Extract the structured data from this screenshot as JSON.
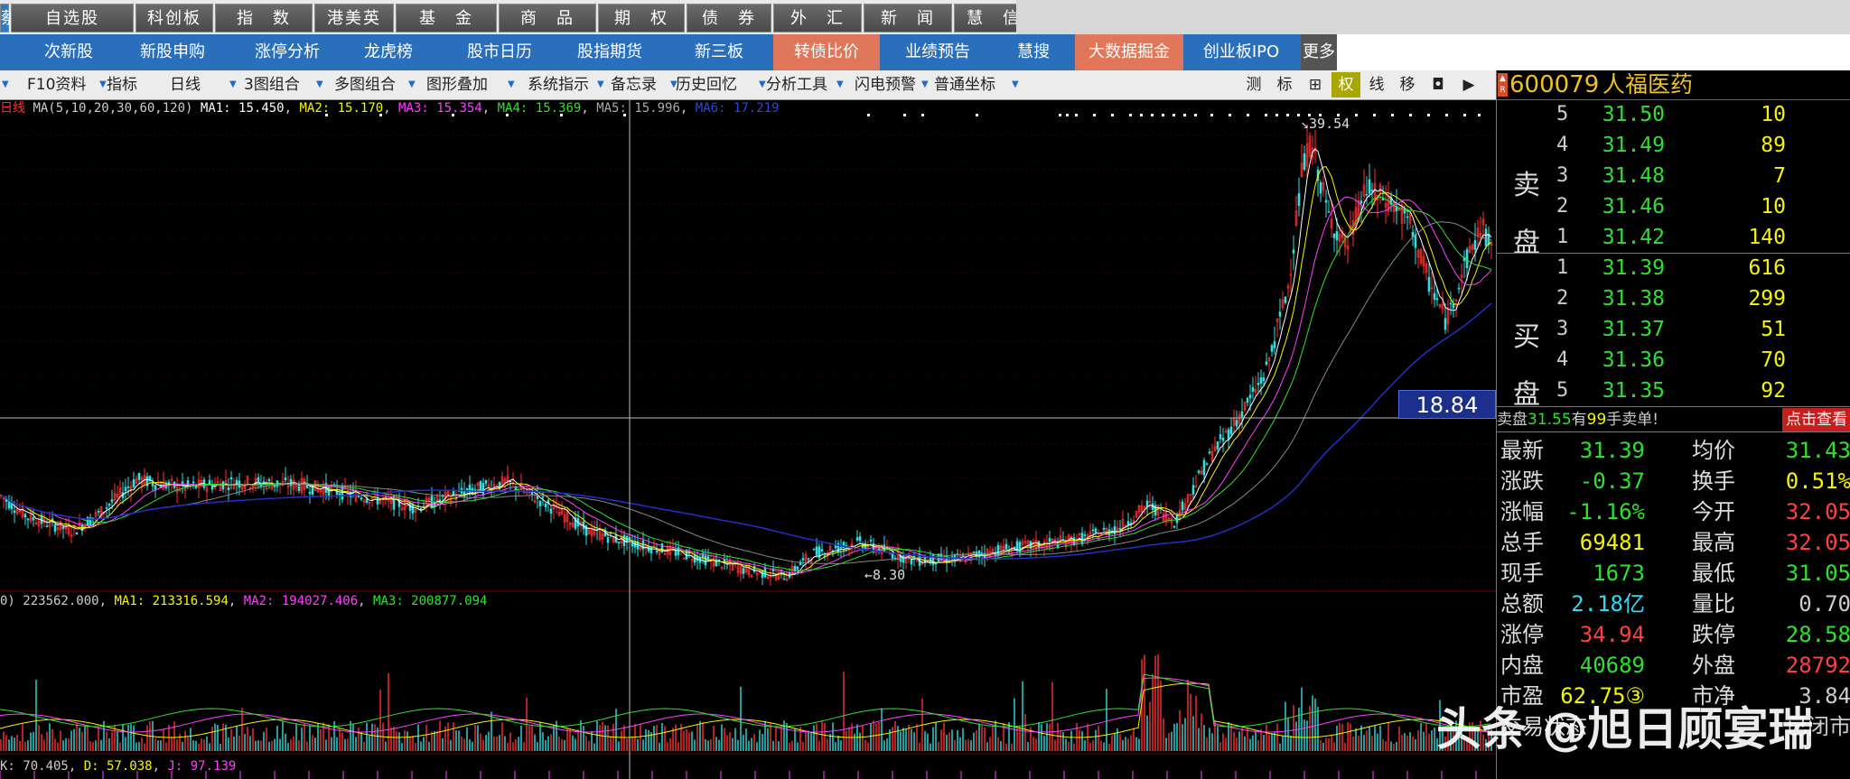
{
  "top_tabs": [
    "蔡",
    "自选股",
    "科创板",
    "指　数",
    "港美英",
    "基　金",
    "商　品",
    "期　权",
    "债　券",
    "外　汇",
    "新　闻",
    "慧　信"
  ],
  "nav_items": [
    "次新股",
    "新股申购",
    "涨停分析",
    "龙虎榜",
    "股市日历",
    "股指期货",
    "新三板",
    "转债比价",
    "业绩预告",
    "慧搜",
    "大数据掘金",
    "创业板IPO",
    "更多"
  ],
  "toolbar": [
    "F10资料",
    "指标",
    "日线",
    "3图组合",
    "多图组合",
    "图形叠加",
    "系统指示",
    "备忘录",
    "历史回忆",
    "分析工具",
    "闪电预警",
    "普通坐标"
  ],
  "right_tools": [
    "测",
    "标",
    "⊞",
    "权",
    "线",
    "移",
    "◘",
    "▶"
  ],
  "chart_info": {
    "label": "日线",
    "ma": "MA(5,10,20,30,60,120)",
    "ma1": "MA1: 15.450",
    "ma2": "MA2: 15.170",
    "ma3": "MA3: 15.354",
    "ma4": "MA4: 15.369",
    "ma5": "MA5: 15.996",
    "ma6": "MA6: 17.219",
    "high_label": "39.54",
    "low_label": "8.30",
    "cursor_price": "18.84"
  },
  "volume_info": {
    "v": "0) 223562.000",
    "ma1": "MA1: 213316.594",
    "ma2": "MA2: 194027.406",
    "ma3": "MA3: 200877.094"
  },
  "kdj_info": {
    "k": "K: 70.405",
    "d": "D: 57.038",
    "j": "J: 97.139"
  },
  "quote": {
    "code": "600079",
    "name": "人福医药",
    "sell_label": "卖\n盘",
    "buy_label": "买\n盘",
    "sell": [
      {
        "level": "5",
        "price": "31.50",
        "vol": "10"
      },
      {
        "level": "4",
        "price": "31.49",
        "vol": "89"
      },
      {
        "level": "3",
        "price": "31.48",
        "vol": "7"
      },
      {
        "level": "2",
        "price": "31.46",
        "vol": "10"
      },
      {
        "level": "1",
        "price": "31.42",
        "vol": "140"
      }
    ],
    "buy": [
      {
        "level": "1",
        "price": "31.39",
        "vol": "616"
      },
      {
        "level": "2",
        "price": "31.38",
        "vol": "299"
      },
      {
        "level": "3",
        "price": "31.37",
        "vol": "51"
      },
      {
        "level": "4",
        "price": "31.36",
        "vol": "70"
      },
      {
        "level": "5",
        "price": "31.35",
        "vol": "92"
      }
    ],
    "sell_notice_pre": "卖盘",
    "sell_notice_price": "31.55",
    "sell_notice_mid": "有",
    "sell_notice_qty": "99",
    "sell_notice_post": "手卖单!",
    "click_view": "点击查看",
    "stats": [
      {
        "l": "最新",
        "lv": "31.39",
        "r": "均价",
        "rv": "31.43"
      },
      {
        "l": "涨跌",
        "lv": "-0.37",
        "r": "换手",
        "rv": "0.51%"
      },
      {
        "l": "涨幅",
        "lv": "-1.16%",
        "r": "今开",
        "rv": "32.05"
      },
      {
        "l": "总手",
        "lv": "69481",
        "r": "最高",
        "rv": "32.05"
      },
      {
        "l": "现手",
        "lv": "1673",
        "r": "最低",
        "rv": "31.05"
      },
      {
        "l": "总额",
        "lv": "2.18亿",
        "r": "量比",
        "rv": "0.70"
      },
      {
        "l": "涨停",
        "lv": "34.94",
        "r": "跌停",
        "rv": "28.58"
      },
      {
        "l": "内盘",
        "lv": "40689",
        "r": "外盘",
        "rv": "28792"
      },
      {
        "l": "市盈",
        "lv": "62.75③",
        "r": "市净",
        "rv": "3.84"
      },
      {
        "l": "交易状态",
        "lv": "",
        "r": "",
        "rv": "已闭市"
      }
    ]
  },
  "watermark": "头条 @旭日顾宴瑞",
  "colors": {
    "up": "#ff4040",
    "down": "#30e030",
    "flat": "#ccc",
    "yellow": "#f5f500",
    "cyan": "#30d8f0"
  }
}
